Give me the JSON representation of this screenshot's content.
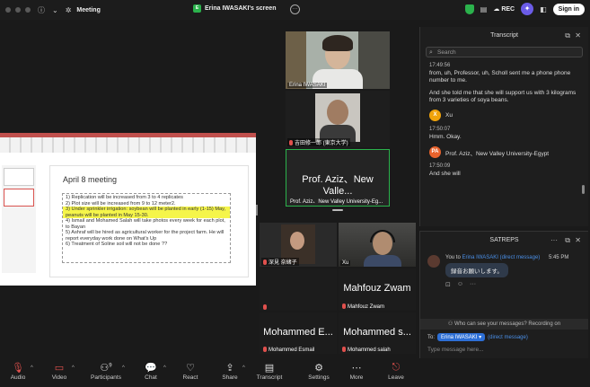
{
  "topbar": {
    "info_icon": "info-icon",
    "meeting_title": "Meeting",
    "share_badge": "E",
    "share_title": "Erina IWASAKI's screen",
    "more_glyph": "···",
    "rec_label": "REC",
    "signin_label": "Sign in"
  },
  "shared_screen": {
    "slide_title": "April 8 meeting",
    "items": [
      "1) Replication will be increased from 3 to 4 replicates",
      "2) Plot size will be increased from 9 to 12 meter2.",
      "3) Under sprinkler irrigation: soybean will be planted in early (1-15) May, peanuts will be planted in May 15-30.",
      "4) Ismail and Mohamed Salah will take photos every week for each plot, to Bayan",
      "5) Ashraf will be hired as agricultural worker for the project farm. He will report everyday work done on What's Up",
      "6) Treatment of  Soline soil will not be done ??"
    ]
  },
  "participants": {
    "erina_label": "Erina IWASAKI",
    "yoshida_label": "吉田修一郎 (東京大学)",
    "aziz_display": "Prof. Aziz、New Valle...",
    "aziz_label": "Prof. Aziz、New Valley University-Eg...",
    "fukami_label": "深見 奈緒子",
    "xu_label": "Xu",
    "mahfouz_display": "Mahfouz Zwam",
    "mahfouz_label": "Mahfouz Zwam",
    "esmail_display": "Mohammed E...",
    "esmail_label": "Mohammed Esmail",
    "salah_display": "Mohammed s...",
    "salah_label": "Mohammed salah"
  },
  "transcript": {
    "title": "Transcript",
    "search_placeholder": "Search",
    "entries": [
      {
        "time": "17:49:56",
        "text": "from, uh, Professor, uh, Scholl sent me a phone phone number to me."
      },
      {
        "time": "",
        "text": "And she told me that she will support us with 3 kilograms from 3 varieties of soya beans."
      }
    ],
    "speaker_xu": {
      "initial": "X",
      "name": "Xu",
      "color": "#f0a30a"
    },
    "time_2": "17:50:07",
    "text_2": "Hmm. Okay.",
    "speaker_aziz": {
      "initial": "PA",
      "name": "Prof. Aziz、New Valley University-Egypt",
      "color": "#e8622c"
    },
    "time_3": "17:50:09",
    "text_3": "And she will"
  },
  "chat": {
    "title": "SATREPS",
    "from": "You to",
    "to_name": "Erina IWASAKI",
    "dm_tag": "(direct message)",
    "time": "5:45 PM",
    "message": "録音お願いします。",
    "notice": "Who can see your messages? Recording on",
    "to_label": "To:",
    "to_chip": "Erina IWASAKI ▾",
    "to_dm": "(direct message)",
    "input_placeholder": "Type message here..."
  },
  "toolbar": {
    "audio": "Audio",
    "video": "Video",
    "participants": "Participants",
    "participants_count": "9",
    "chat": "Chat",
    "react": "React",
    "share": "Share",
    "transcript": "Transcript",
    "settings": "Settings",
    "more": "More",
    "leave": "Leave"
  },
  "colors": {
    "accent": "#2d6fd6",
    "active_speaker": "#2bb24c",
    "muted": "#e0504d"
  }
}
